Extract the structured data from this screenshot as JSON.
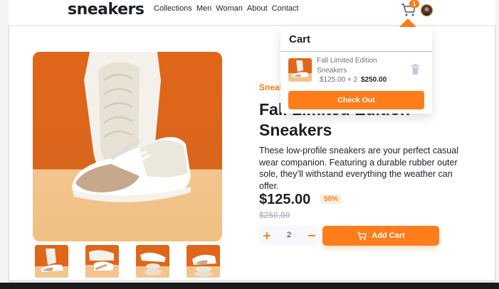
{
  "header": {
    "logo": "sneakers",
    "nav": [
      "Collections",
      "Men",
      "Woman",
      "About",
      "Contact"
    ],
    "cart_badge": "1",
    "icons": {
      "cart": "cart-icon",
      "avatar": "user-avatar"
    }
  },
  "product": {
    "brand": "Sneaker Company",
    "title": "Fall Limited Edition Sneakers",
    "description": "These low-profile sneakers are your perfect casual wear companion. Featuring a durable rubber outer sole, they’ll withstand everything the weather can offer.",
    "price": "$125.00",
    "discount": "50%",
    "old_price": "$250.00",
    "quantity": "2",
    "qty_plus": "+",
    "qty_minus": "−",
    "add_to_cart": "Add Cart"
  },
  "cart": {
    "title": "Cart",
    "item_name": "Fall Limited Edition Sneakers",
    "item_calc": "$125.00 × 2",
    "item_total": "$250.00",
    "checkout": "Check Out"
  },
  "colors": {
    "accent": "#ff7e1b",
    "dark": "#1d2026",
    "muted": "#69707d"
  }
}
